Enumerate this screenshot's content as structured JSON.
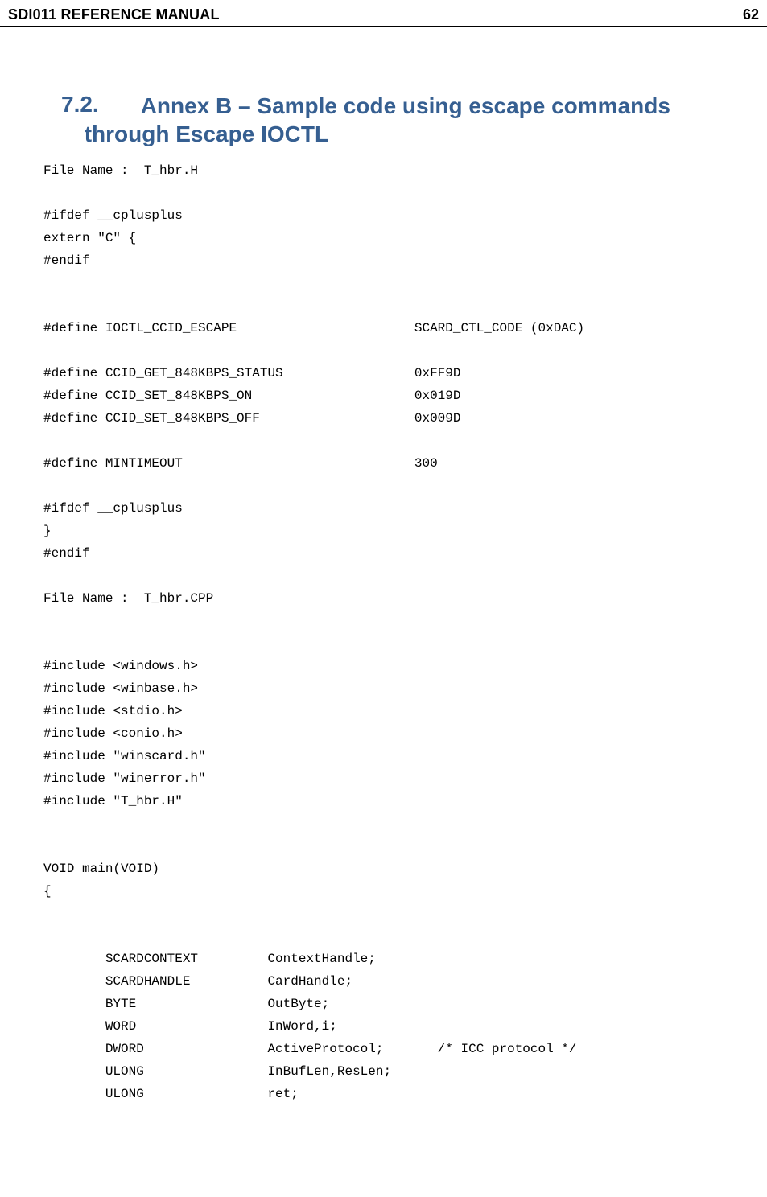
{
  "header": {
    "title": "SDI011 REFERENCE MANUAL",
    "page": "62"
  },
  "section": {
    "number": "7.2.",
    "title_line1": "Annex B – Sample code using escape commands",
    "title_line2": "through Escape IOCTL"
  },
  "code": {
    "l1": "File Name :  T_hbr.H",
    "l2": "",
    "l3": "#ifdef __cplusplus",
    "l4": "extern \"C\" {",
    "l5": "#endif",
    "l6": "",
    "l7": "",
    "l8": "#define IOCTL_CCID_ESCAPE                       SCARD_CTL_CODE (0xDAC)",
    "l9": "",
    "l10": "#define CCID_GET_848KBPS_STATUS                 0xFF9D",
    "l11": "#define CCID_SET_848KBPS_ON                     0x019D",
    "l12": "#define CCID_SET_848KBPS_OFF                    0x009D",
    "l13": "",
    "l14": "#define MINTIMEOUT                              300",
    "l15": "",
    "l16": "#ifdef __cplusplus",
    "l17": "}",
    "l18": "#endif",
    "l19": "",
    "l20": "File Name :  T_hbr.CPP",
    "l21": "",
    "l22": "",
    "l23": "#include <windows.h>",
    "l24": "#include <winbase.h>",
    "l25": "#include <stdio.h>",
    "l26": "#include <conio.h>",
    "l27": "#include \"winscard.h\"",
    "l28": "#include \"winerror.h\"",
    "l29": "#include \"T_hbr.H\"",
    "l30": "",
    "l31": "",
    "l32": "VOID main(VOID)",
    "l33": "{",
    "l34": "",
    "l35": "",
    "l36": "        SCARDCONTEXT         ContextHandle;",
    "l37": "        SCARDHANDLE          CardHandle;",
    "l38": "        BYTE                 OutByte;",
    "l39": "        WORD                 InWord,i;",
    "l40": "        DWORD                ActiveProtocol;       /* ICC protocol */",
    "l41": "        ULONG                InBufLen,ResLen;",
    "l42": "        ULONG                ret;"
  }
}
